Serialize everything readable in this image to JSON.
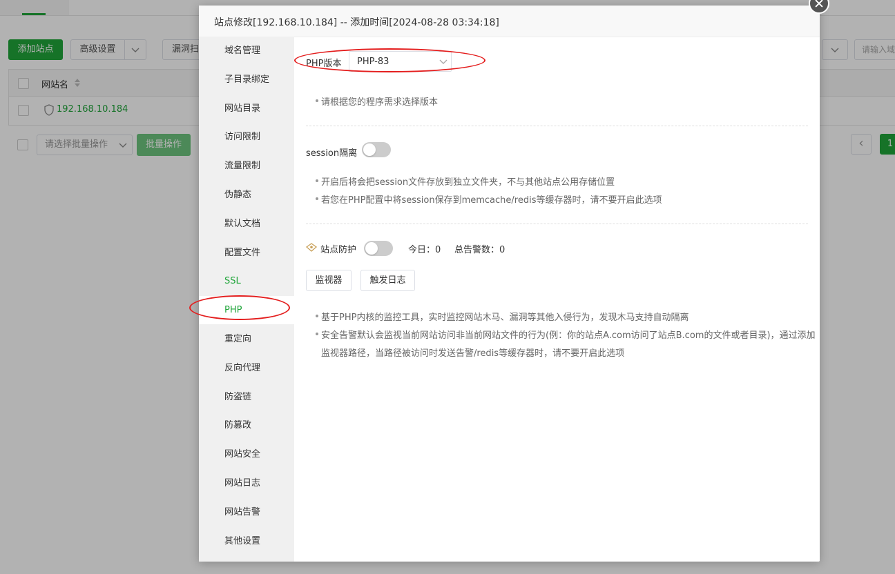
{
  "background": {
    "toolbar": {
      "add_site": "添加站点",
      "advanced_settings": "高级设置",
      "vuln_scan_partial": "漏洞扫",
      "search_placeholder_partial": "请输入域"
    },
    "table": {
      "header_site_name": "网站名",
      "rows": [
        {
          "site": "192.168.10.184"
        }
      ]
    },
    "footer": {
      "batch_select_placeholder": "请选择批量操作",
      "batch_button": "批量操作",
      "page_prev": "‹",
      "page_current": "1"
    }
  },
  "modal": {
    "title": "站点修改[192.168.10.184] -- 添加时间[2024-08-28 03:34:18]",
    "menu": [
      "域名管理",
      "子目录绑定",
      "网站目录",
      "访问限制",
      "流量限制",
      "伪静态",
      "默认文档",
      "配置文件",
      "SSL",
      "PHP",
      "重定向",
      "反向代理",
      "防盗链",
      "防篡改",
      "网站安全",
      "网站日志",
      "网站告警",
      "其他设置"
    ],
    "active_menu": "PHP",
    "php": {
      "version_label": "PHP版本",
      "version_value": "PHP-83",
      "version_tip": "请根据您的程序需求选择版本"
    },
    "session": {
      "label": "session隔离",
      "enabled": false,
      "tips": [
        "开启后将会把session文件存放到独立文件夹，不与其他站点公用存储位置",
        "若您在PHP配置中将session保存到memcache/redis等缓存器时，请不要开启此选项"
      ]
    },
    "protection": {
      "label": "站点防护",
      "enabled": false,
      "today": "今日：0",
      "total_alarms": "总告警数：0",
      "monitor_button": "监视器",
      "trigger_log_button": "触发日志",
      "tips": [
        "基于PHP内核的监控工具，实时监控网站木马、漏洞等其他入侵行为，发现木马支持自动隔离",
        "安全告警默认会监视当前网站访问非当前网站文件的行为(例：你的站点A.com访问了站点B.com的文件或者目录)，通过添加",
        "监视器路径，当路径被访问时发送告警/redis等缓存器时，请不要开启此选项"
      ]
    }
  },
  "colors": {
    "brand_green": "#20a53a",
    "annotation_red": "#e41e1e"
  },
  "icons": [
    "close-icon",
    "chevron-down-icon",
    "shield-icon",
    "sort-icon",
    "eye-diamond-icon"
  ]
}
